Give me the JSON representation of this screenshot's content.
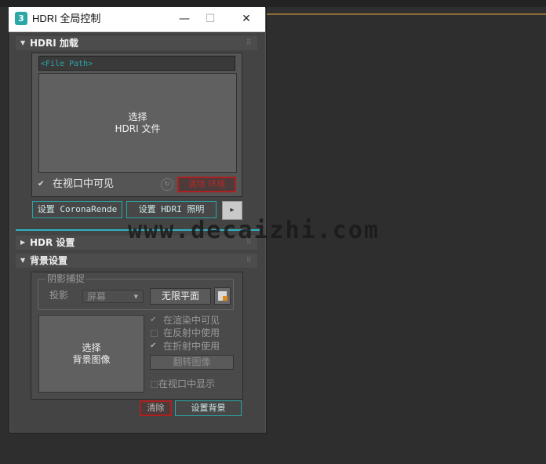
{
  "window": {
    "title": "HDRI 全局控制",
    "app_icon": "3",
    "minimize": "—",
    "maximize": "☐",
    "close": "✕"
  },
  "sections": {
    "hdri_load": {
      "title": "HDRI 加载",
      "file_path": "<File Path>",
      "select_line1": "选择",
      "select_line2": "HDRI 文件",
      "visible_label": "在视口中可见",
      "visible_checked": true,
      "clear_btn": "清除 环境",
      "btn_corona": "设置 CoronaRende",
      "btn_hdri_light": "设置 HDRI 照明",
      "btn_arrow": "▸"
    },
    "hdr_settings": {
      "title": "HDR 设置"
    },
    "background": {
      "title": "背景设置",
      "shadow_group": "阴影捕捉",
      "projection_label": "投影",
      "projection_value": "屏幕",
      "infinite_plane_btn": "无限平面",
      "select_line1": "选择",
      "select_line2": "背景图像",
      "opt_render": "在渲染中可见",
      "opt_reflect": "在反射中使用",
      "opt_refract": "在折射中使用",
      "flip_btn": "翻转图像",
      "opt_viewport": "在视口中显示",
      "clear_btn": "清除",
      "set_bg_btn": "设置背景"
    }
  },
  "watermark": "www.decaizhi.com",
  "colors": {
    "accent": "#2aa7a7",
    "danger": "#b01f1f",
    "panel": "#444444"
  }
}
